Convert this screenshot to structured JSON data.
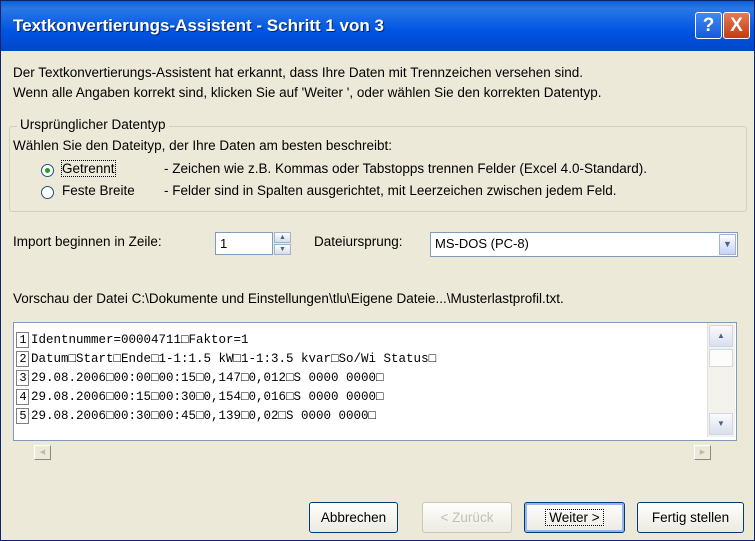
{
  "window": {
    "title": "Textkonvertierungs-Assistent - Schritt 1 von 3",
    "help_glyph": "?",
    "close_glyph": "X",
    "accent_color": "#0054e3"
  },
  "intro": {
    "line1": "Der Textkonvertierungs-Assistent hat erkannt, dass Ihre Daten mit Trennzeichen versehen sind.",
    "line2": "Wenn alle Angaben korrekt sind, klicken Sie auf 'Weiter ', oder wählen Sie den korrekten Datentyp."
  },
  "datatype": {
    "group_title": "Ursprünglicher Datentyp",
    "prompt": "Wählen Sie den Dateityp, der Ihre Daten am besten beschreibt:",
    "options": [
      {
        "label": "Getrennt",
        "description": "- Zeichen wie z.B. Kommas oder Tabstopps trennen Felder (Excel 4.0-Standard).",
        "selected": true
      },
      {
        "label": "Feste Breite",
        "description": "- Felder sind in Spalten ausgerichtet, mit Leerzeichen zwischen jedem Feld.",
        "selected": false
      }
    ]
  },
  "import_start": {
    "label": "Import beginnen in Zeile:",
    "value": "1"
  },
  "file_origin": {
    "label": "Dateiursprung:",
    "value": "MS-DOS (PC-8)"
  },
  "preview": {
    "label": "Vorschau der Datei C:\\Dokumente und Einstellungen\\tlu\\Eigene Dateie...\\Musterlastprofil.txt.",
    "rows": [
      {
        "num": "1",
        "text": "Identnummer=00004711□Faktor=1"
      },
      {
        "num": "2",
        "text": "Datum□Start□Ende□1-1:1.5 kW□1-1:3.5 kvar□So/Wi Status□"
      },
      {
        "num": "3",
        "text": "29.08.2006□00:00□00:15□0,147□0,012□S 0000 0000□"
      },
      {
        "num": "4",
        "text": "29.08.2006□00:15□00:30□0,154□0,016□S 0000 0000□"
      },
      {
        "num": "5",
        "text": "29.08.2006□00:30□00:45□0,139□0,02□S 0000 0000□"
      }
    ]
  },
  "buttons": {
    "cancel": "Abbrechen",
    "back": "< Zurück",
    "next": "Weiter >",
    "finish": "Fertig stellen"
  }
}
